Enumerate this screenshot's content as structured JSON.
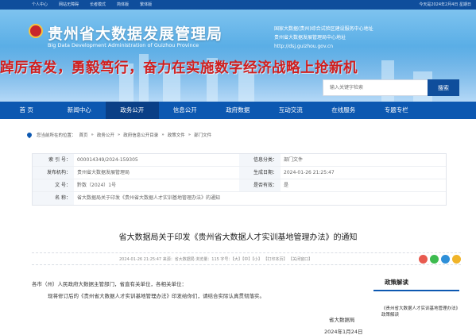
{
  "topbar": {
    "links": [
      "个人中心",
      "网站无障碍",
      "长者模式",
      "简体版",
      "繁体版"
    ],
    "date": "今天是2024年2月4日 星期日"
  },
  "banner": {
    "title": "贵州省大数据发展管理局",
    "subtitle": "Big Data Development Administration of Guizhou Province",
    "info_lines": [
      "国家大数据(贵州)综合试验区建设服务中心地址",
      "贵州省大数据发展管理局中心地址",
      "http://dsj.guizhou.gov.cn"
    ],
    "slogan": "踔厉奋发，勇毅笃行，奋力在实施数字经济战略上抢新机",
    "search_placeholder": "输入关键字检索",
    "search_button": "搜索"
  },
  "nav": [
    {
      "label": "首  页",
      "active": false
    },
    {
      "label": "新闻中心",
      "active": false
    },
    {
      "label": "政务公开",
      "active": true
    },
    {
      "label": "信息公开",
      "active": false
    },
    {
      "label": "政府数据",
      "active": false
    },
    {
      "label": "互动交流",
      "active": false
    },
    {
      "label": "在线服务",
      "active": false
    },
    {
      "label": "专题专栏",
      "active": false
    },
    {
      "label": "",
      "active": false
    }
  ],
  "breadcrumb": {
    "prefix": "您当前所在的位置：",
    "items": [
      "首页",
      "政务公开",
      "政府信息公开目录",
      "政策文件",
      "部门文件"
    ]
  },
  "info": {
    "index_label": "索 引 号：",
    "index_value": "000014349/2024-159305",
    "category_label": "信息分类：",
    "category_value": "部门文件",
    "org_label": "发布机构：",
    "org_value": "贵州省大数据发展管理局",
    "date_label": "生成日期：",
    "date_value": "2024-01-26 21:25:47",
    "num_label": "文    号：",
    "num_value": "黔数（2024）1号",
    "valid_label": "是否有效：",
    "valid_value": "是",
    "name_label": "名    称：",
    "name_value": "省大数据局关于印发《贵州省大数据人才实训基地管理办法》的通知"
  },
  "article": {
    "title": "省大数据局关于印发《贵州省大数据人才实训基地管理办法》的通知",
    "meta": "2024-01-26 21:25:47   来源：省大数据局   浏览量：115   字号：【大】【中】【小】  【打印本页】  【关闭窗口】",
    "para1": "各市（州）人民政府大数据主管部门，省直有关单位，各相关单位：",
    "para2": "现将修订后的《贵州省大数据人才实训基地管理办法》印发给你们，请结合实际认真贯彻落实。",
    "signature": "省大数据局",
    "sign_date": "2024年1月24日"
  },
  "sidebar": {
    "heading": "政策解读",
    "entry": "《贵州省大数据人才实训基地管理办法》政策解读"
  },
  "colors": {
    "primary": "#0c58b1",
    "nav_active": "#0a3f86",
    "slogan": "#d01f1f"
  }
}
